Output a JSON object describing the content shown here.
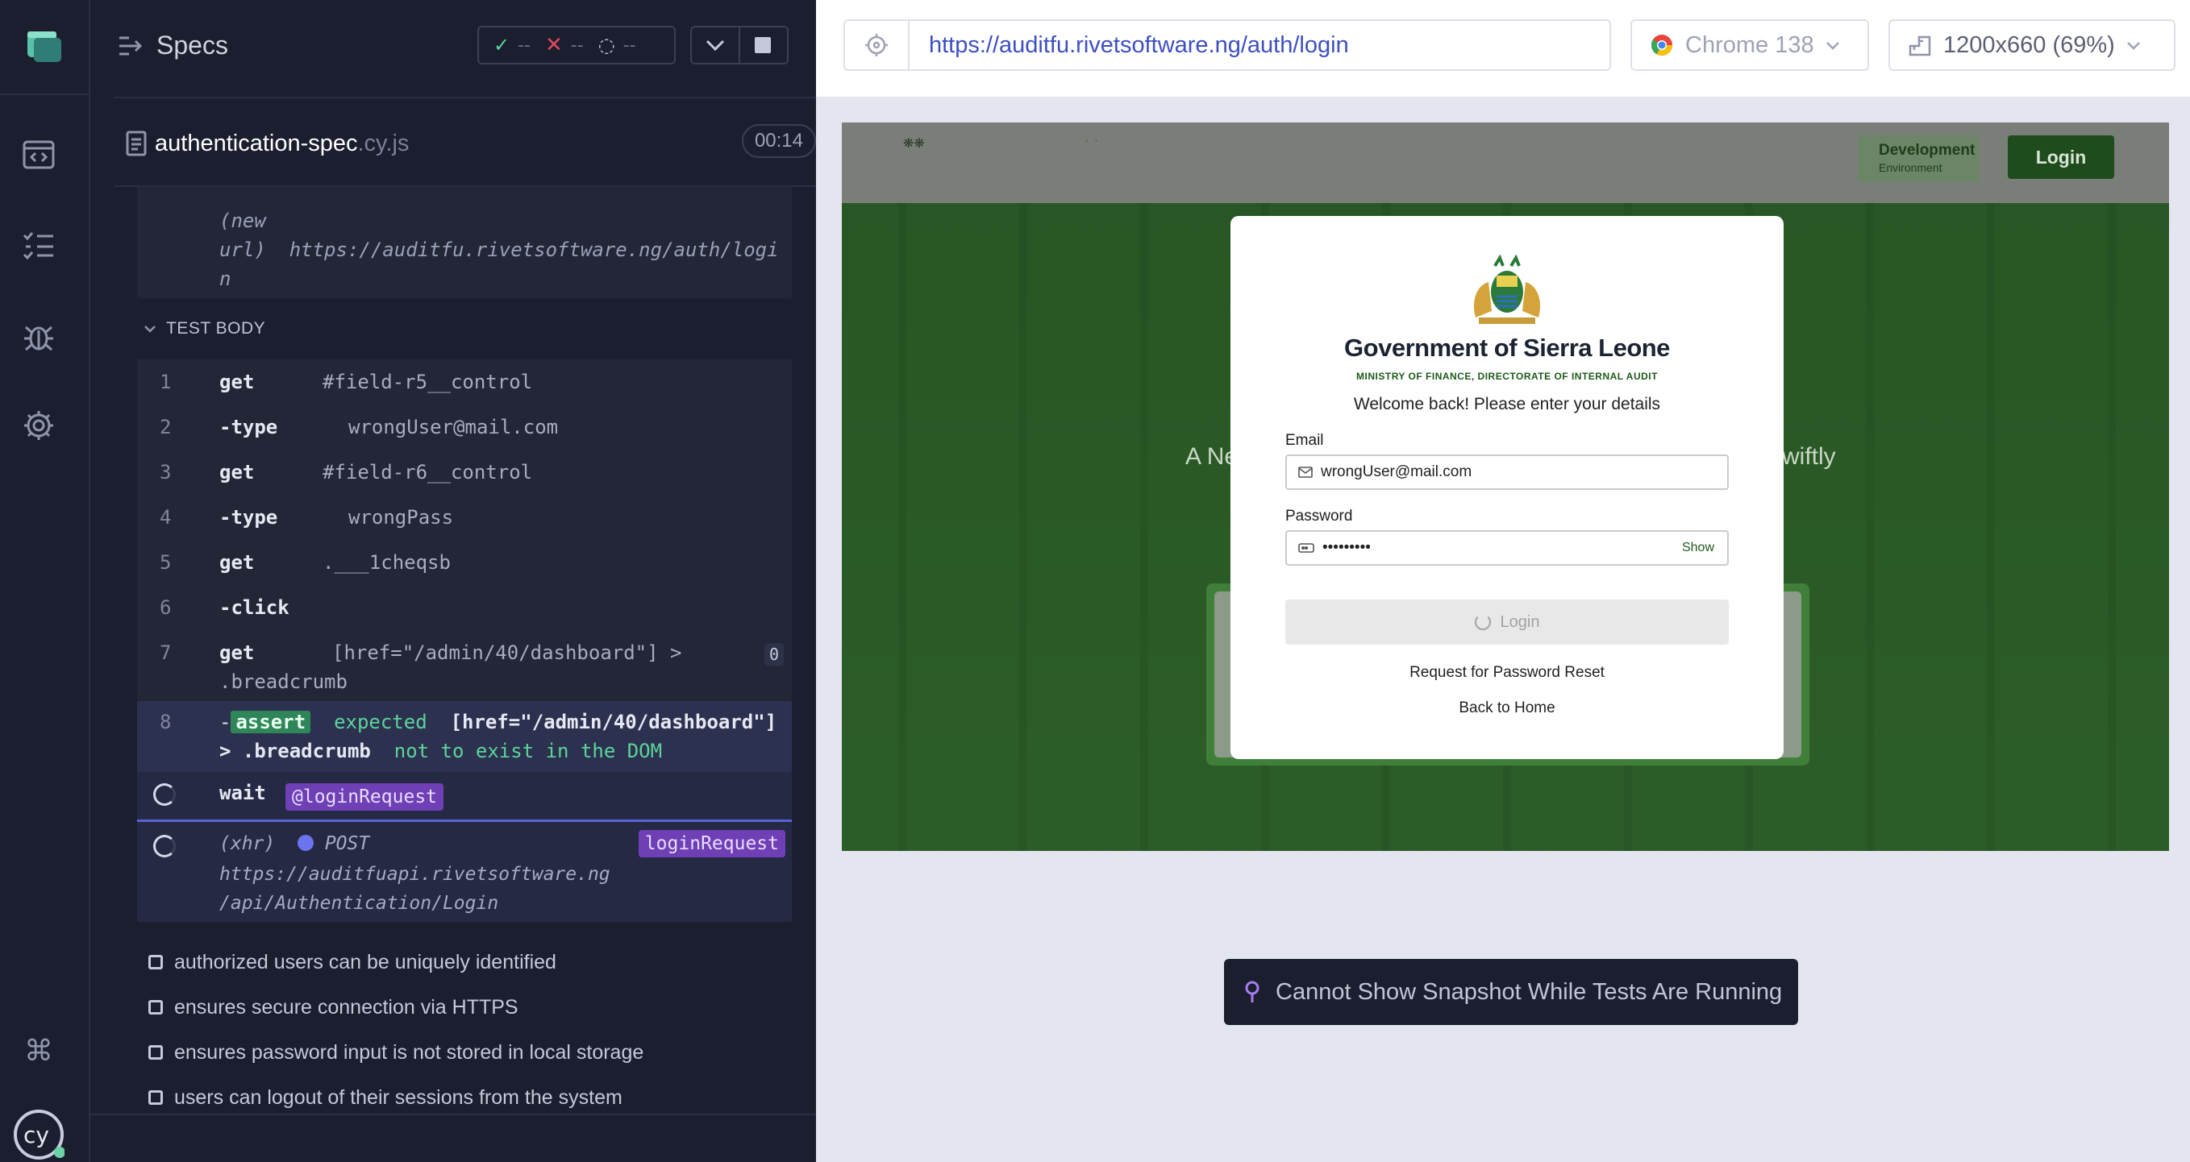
{
  "runner": {
    "title": "Specs",
    "stats": {
      "passed": "--",
      "failed": "--",
      "pending": "--"
    },
    "spec": {
      "name": "authentication-spec",
      "ext": ".cy.js",
      "duration": "00:14"
    },
    "prev_command": {
      "line1": "(new",
      "line2": "url)",
      "url_a": "https://auditfu.rivetsoftware.ng/auth/logi",
      "url_b": "n"
    },
    "section_label": "TEST BODY",
    "commands": [
      {
        "num": "1",
        "name": "get",
        "arg": "#field-r5__control"
      },
      {
        "num": "2",
        "name": "-type",
        "arg": "wrongUser@mail.com"
      },
      {
        "num": "3",
        "name": "get",
        "arg": "#field-r6__control"
      },
      {
        "num": "4",
        "name": "-type",
        "arg": "wrongPass"
      },
      {
        "num": "5",
        "name": "get",
        "arg": ".___1cheqsb"
      },
      {
        "num": "6",
        "name": "-click",
        "arg": ""
      },
      {
        "num": "7",
        "name": "get",
        "arg": "[href=\"/admin/40/dashboard\"] >",
        "arg2": ".breadcrumb",
        "badge": "0"
      }
    ],
    "assert": {
      "num": "8",
      "dash": "-",
      "keyword": "assert",
      "expected": "expected",
      "selector_a": "[href=\"/admin/40/dashboard\"]",
      "selector_b": "> .breadcrumb",
      "tail": "not to exist in the DOM"
    },
    "wait": {
      "name": "wait",
      "alias": "@loginRequest"
    },
    "xhr": {
      "kind": "(xhr)",
      "method": "POST",
      "url_a": "https://auditfuapi.rivetsoftware.ng",
      "url_b": "/api/Authentication/Login",
      "alias": "loginRequest"
    },
    "tests": [
      "authorized users can be uniquely identified",
      "ensures secure connection via HTTPS",
      "ensures password input is not stored in local storage",
      "users can logout of their sessions from the system"
    ]
  },
  "toolbar": {
    "url": "https://auditfu.rivetsoftware.ng/auth/login",
    "browser": "Chrome 138",
    "viewport": "1200x660 (69%)"
  },
  "aut": {
    "env_badge": {
      "title": "Development",
      "sub": "Environment"
    },
    "nav_login": "Login",
    "hero_left": "A Ne",
    "hero_right": "wiftly",
    "modal": {
      "title": "Government of Sierra Leone",
      "ministry": "MINISTRY OF FINANCE, DIRECTORATE OF INTERNAL AUDIT",
      "welcome": "Welcome back! Please enter your details",
      "email_label": "Email",
      "email_value": "wrongUser@mail.com",
      "password_label": "Password",
      "password_value": "•••••••••",
      "show": "Show",
      "login": "Login",
      "reset": "Request for Password Reset",
      "home": "Back to Home"
    }
  },
  "toast": "Cannot Show Snapshot While Tests Are Running",
  "colors": {
    "accent": "#3d4fc2",
    "pass": "#5bd49a",
    "fail": "#e0485a",
    "alias": "#6e3fb5",
    "brand_green": "#1d5a1a"
  }
}
